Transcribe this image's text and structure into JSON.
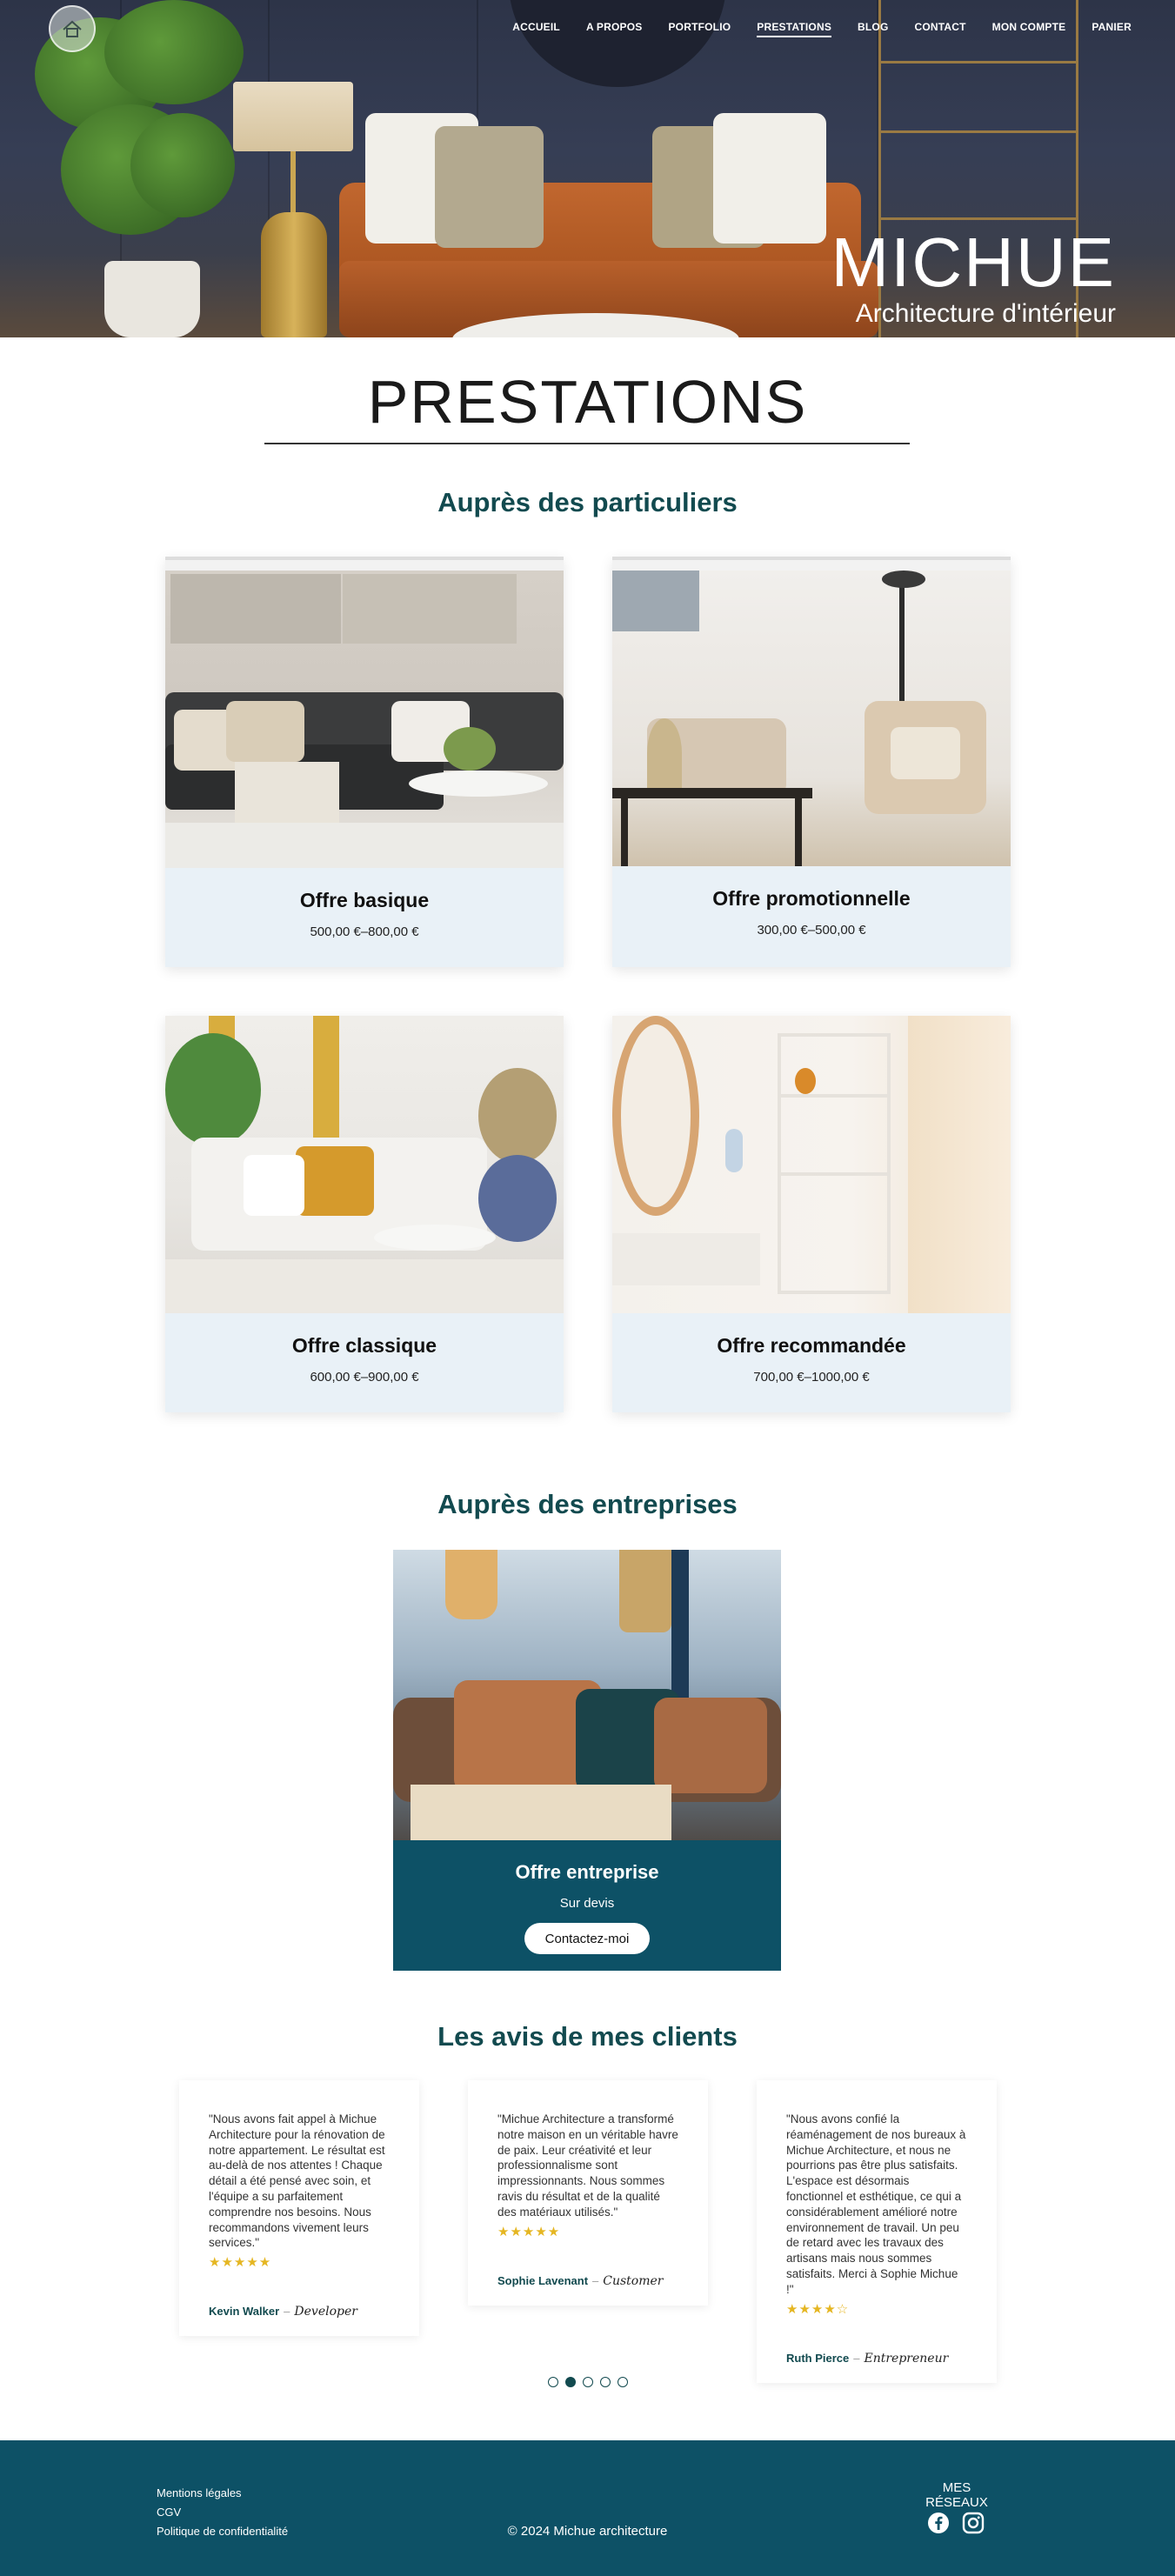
{
  "header": {
    "logo_alt": "Michue Architecture logo",
    "nav": [
      {
        "label": "ACCUEIL",
        "active": false
      },
      {
        "label": "A PROPOS",
        "active": false
      },
      {
        "label": "PORTFOLIO",
        "active": false
      },
      {
        "label": "PRESTATIONS",
        "active": true
      },
      {
        "label": "BLOG",
        "active": false
      },
      {
        "label": "CONTACT",
        "active": false
      },
      {
        "label": "MON COMPTE",
        "active": false
      },
      {
        "label": "PANIER",
        "active": false
      }
    ],
    "brand_name": "MICHUE",
    "brand_tagline": "Architecture d'intérieur"
  },
  "page_title": "PRESTATIONS",
  "particuliers": {
    "heading": "Auprès des particuliers",
    "offers": [
      {
        "title": "Offre basique",
        "price": "500,00 €–800,00 €"
      },
      {
        "title": "Offre promotionnelle",
        "price": "300,00 €–500,00 €"
      },
      {
        "title": "Offre classique",
        "price": "600,00 €–900,00 €"
      },
      {
        "title": "Offre recommandée",
        "price": "700,00 €–1000,00 €"
      }
    ]
  },
  "entreprises": {
    "heading": "Auprès des entreprises",
    "offer_title": "Offre entreprise",
    "offer_sub": "Sur devis",
    "button": "Contactez-moi"
  },
  "reviews": {
    "heading": "Les avis de mes clients",
    "items": [
      {
        "text": "\"Nous avons fait appel à Michue Architecture pour la rénovation de notre appartement. Le résultat est au-delà de nos attentes ! Chaque détail a été pensé avec soin, et l'équipe a su parfaitement comprendre nos besoins. Nous recommandons vivement leurs services.\"",
        "stars": "★★★★★",
        "rating": 5,
        "author": "Kevin Walker",
        "role": "Developer"
      },
      {
        "text": "\"Michue Architecture a transformé notre maison en un véritable havre de paix. Leur créativité et leur professionnalisme sont impressionnants. Nous sommes ravis du résultat et de la qualité des matériaux utilisés.\"",
        "stars": "★★★★★",
        "rating": 5,
        "author": "Sophie Lavenant",
        "role": "Customer"
      },
      {
        "text": "\"Nous avons confié la réaménagement de nos bureaux à Michue Architecture, et nous ne pourrions pas être plus satisfaits. L'espace est désormais fonctionnel et esthétique, ce qui a considérablement amélioré notre environnement de travail. Un peu de retard avec les travaux des artisans mais nous sommes satisfaits. Merci à Sophie Michue !\"",
        "stars": "★★★★☆",
        "rating": 4,
        "author": "Ruth Pierce",
        "role": "Entrepreneur"
      }
    ],
    "dots": 5,
    "active_dot": 2
  },
  "footer": {
    "links": [
      "Mentions légales",
      "CGV",
      "Politique de confidentialité"
    ],
    "copyright": "© 2024 Michue architecture",
    "social_heading": "MES RÉSEAUX",
    "social_icons": [
      "facebook-icon",
      "instagram-icon"
    ]
  },
  "colors": {
    "primary_dark_teal": "#0d5166",
    "heading_teal": "#124a4f",
    "card_bg": "#e9f1f7",
    "star": "#e5b622"
  }
}
